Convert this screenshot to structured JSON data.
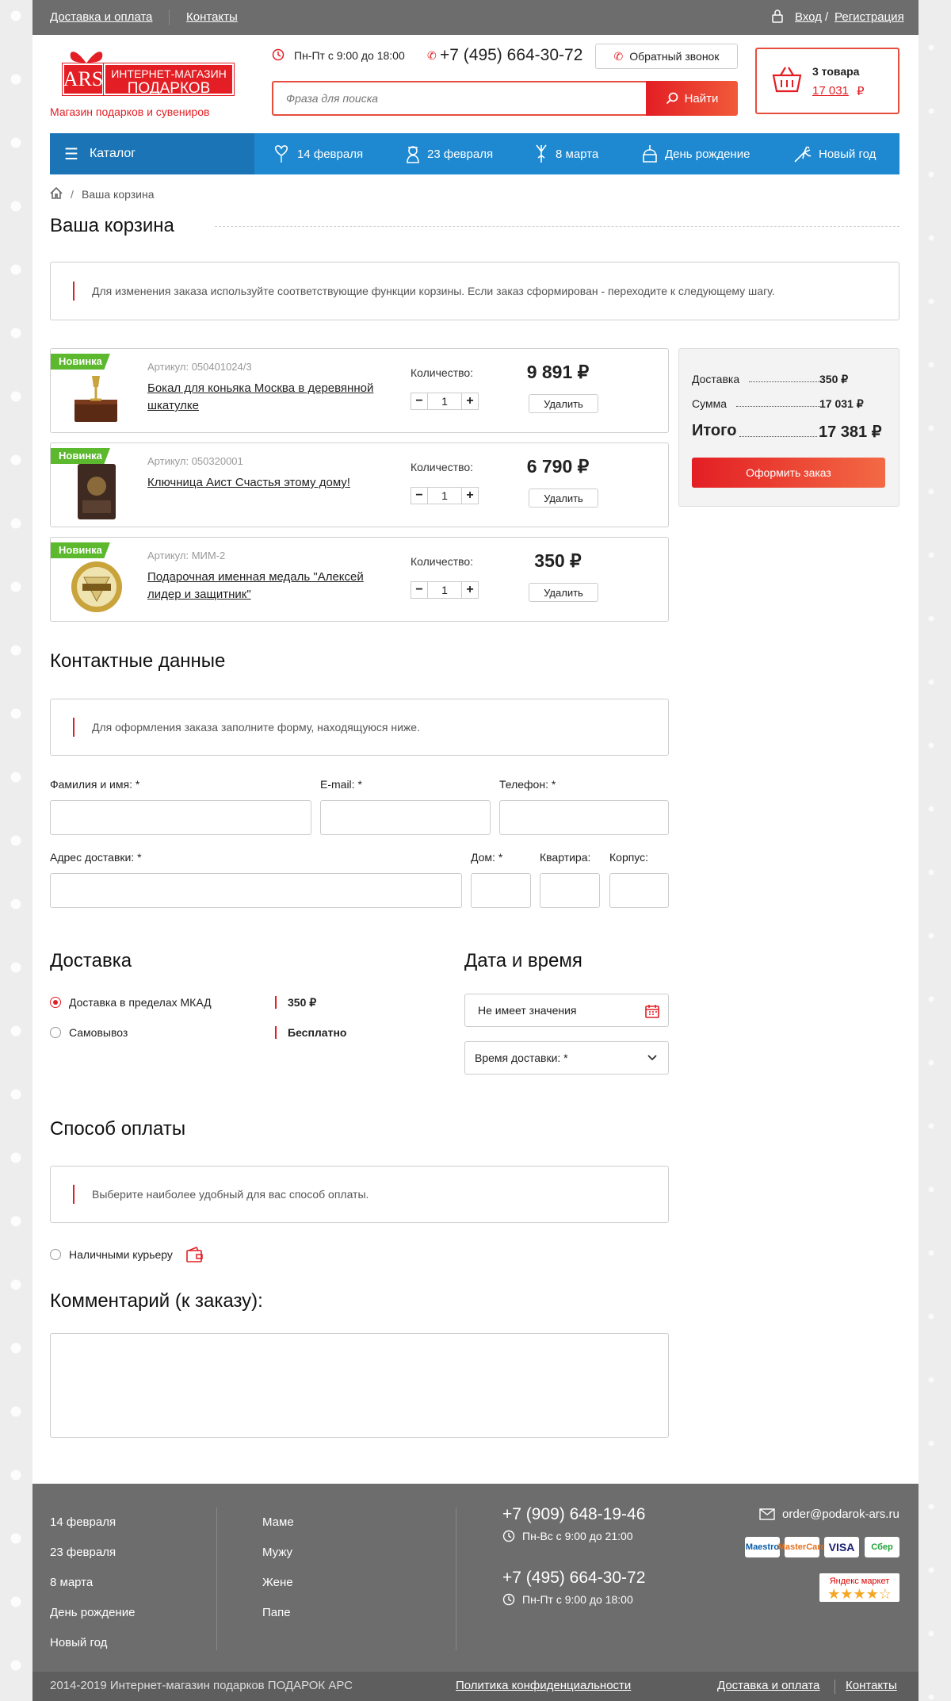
{
  "topbar": {
    "delivery": "Доставка и оплата",
    "contacts": "Контакты",
    "login": "Вход",
    "sep": "/",
    "register": "Регистрация"
  },
  "header": {
    "logo_ars": "ARS",
    "logo_line1": "ИНТЕРНЕТ-МАГАЗИН",
    "logo_line2": "ПОДАРКОВ",
    "tagline": "Магазин подарков и сувениров",
    "hours": "Пн-Пт с 9:00 до 18:00",
    "phone": "+7 (495) 664-30-72",
    "callback": "Обратный звонок",
    "search_placeholder": "Фраза для поиска",
    "search_button": "Найти",
    "cart_count": "3 товара",
    "cart_sum": "17 031",
    "currency": "₽"
  },
  "nav": {
    "catalog": "Каталог",
    "items": [
      {
        "label": "14 февраля",
        "icon": "balloon-icon"
      },
      {
        "label": "23 февраля",
        "icon": "soldier-icon"
      },
      {
        "label": "8 марта",
        "icon": "flower-icon"
      },
      {
        "label": "День рождение",
        "icon": "cake-icon"
      },
      {
        "label": "Новый год",
        "icon": "firework-icon"
      }
    ]
  },
  "breadcrumb": {
    "current": "Ваша корзина",
    "sep": "/"
  },
  "cart": {
    "title": "Ваша корзина",
    "note": "Для изменения заказа используйте соответствующие функции корзины. Если заказ сформирован - переходите к следующему шагу.",
    "qty_label": "Количество:",
    "remove": "Удалить",
    "badge": "Новинка",
    "items": [
      {
        "article": "Артикул: 050401024/3",
        "name": "Бокал для коньяка Москва в деревянной шкатулке",
        "qty": "1",
        "price": "9 891 ₽"
      },
      {
        "article": "Артикул: 050320001",
        "name": "Ключница Аист Счастья этому дому!",
        "qty": "1",
        "price": "6 790 ₽"
      },
      {
        "article": "Артикул: МИМ-2",
        "name": "Подарочная именная медаль \"Алексей лидер и защитник\"",
        "qty": "1",
        "price": "350 ₽"
      }
    ]
  },
  "summary": {
    "delivery_label": "Доставка",
    "delivery_value": "350 ₽",
    "sum_label": "Сумма",
    "sum_value": "17 031 ₽",
    "total_label": "Итого",
    "total_value": "17 381 ₽",
    "order_button": "Оформить заказ"
  },
  "contacts": {
    "title": "Контактные данные",
    "note": "Для оформления заказа заполните форму, находящуюся ниже.",
    "name_label": "Фамилия и имя: *",
    "email_label": "E-mail: *",
    "phone_label": "Телефон: *",
    "address_label": "Адрес доставки: *",
    "house_label": "Дом: *",
    "flat_label": "Квартира:",
    "corp_label": "Корпус:"
  },
  "delivery": {
    "title": "Доставка",
    "options": [
      {
        "label": "Доставка в пределах МКАД",
        "price": "350 ₽",
        "selected": true
      },
      {
        "label": "Самовывоз",
        "price": "Бесплатно",
        "selected": false
      }
    ]
  },
  "datetime": {
    "title": "Дата и время",
    "date_value": "Не имеет значения",
    "time_label": "Время доставки: *"
  },
  "payment": {
    "title": "Способ оплаты",
    "note": "Выберите наиболее удобный для вас способ оплаты.",
    "option": "Наличными курьеру"
  },
  "comment": {
    "title": "Комментарий (к заказу):"
  },
  "footer": {
    "col1": [
      "14 февраля",
      "23 февраля",
      "8 марта",
      "День рождение",
      "Новый год"
    ],
    "col2": [
      "Маме",
      "Мужу",
      "Жене",
      "Папе"
    ],
    "phone1": "+7 (909) 648-19-46",
    "hours1": "Пн-Вс с 9:00 до 21:00",
    "phone2": "+7 (495) 664-30-72",
    "hours2": "Пн-Пт с 9:00 до 18:00",
    "email": "order@podarok-ars.ru",
    "payments": [
      "Maestro",
      "MasterCard",
      "VISA",
      "Сбер"
    ],
    "market_line1": "Яндекс маркет",
    "market_stars": "★★★★☆",
    "copyright": "2014-2019 Интернет-магазин подарков ПОДАРОК АРС",
    "privacy": "Политика конфиденциальности",
    "delivery": "Доставка и оплата",
    "contacts": "Контакты"
  },
  "colors": {
    "accent": "#e31e24",
    "nav": "#1e88d0",
    "nav_dark": "#1a74b5",
    "new_badge": "#5cb82d",
    "footer": "#6d6d6d"
  }
}
